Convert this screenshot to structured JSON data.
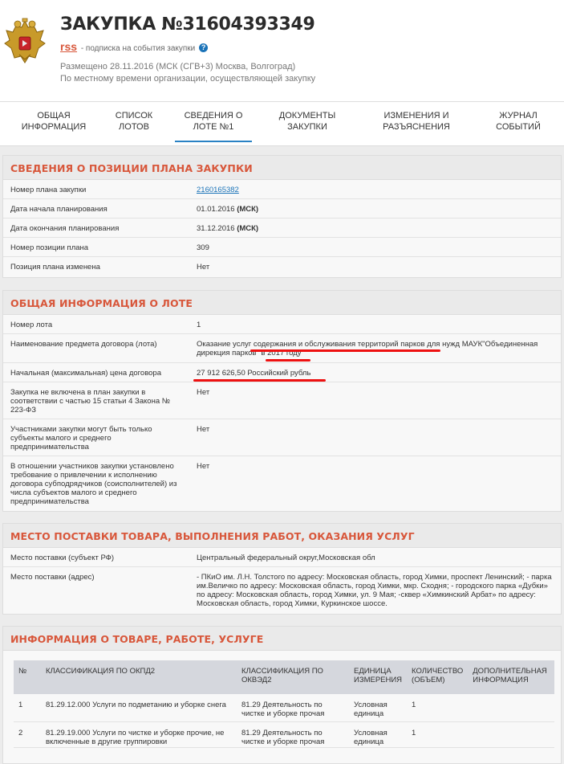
{
  "header": {
    "title": "ЗАКУПКА №31604393349",
    "rss_label": "rss",
    "rss_note": "- подписка на события закупки",
    "help_icon": "?",
    "posted_line1": "Размещено 28.11.2016 (МСК (СГВ+3) Москва, Волгоград)",
    "posted_line2": "По местному времени организации, осуществляющей закупку"
  },
  "tabs": [
    {
      "line1": "Общая",
      "line2": "информация"
    },
    {
      "line1": "Список",
      "line2": "лотов"
    },
    {
      "line1": "Сведения о",
      "line2": "лоте №1"
    },
    {
      "line1": "Документы",
      "line2": "закупки"
    },
    {
      "line1": "Изменения и",
      "line2": "разъяснения"
    },
    {
      "line1": "Журнал",
      "line2": "событий"
    }
  ],
  "plan": {
    "title": "Сведения о позиции плана закупки",
    "rows": [
      {
        "label": "Номер плана закупки",
        "value": "2160165382"
      },
      {
        "label": "Дата начала планирования",
        "value": "01.01.2016",
        "suffix": "(МСК)"
      },
      {
        "label": "Дата окончания планирования",
        "value": "31.12.2016",
        "suffix": "(МСК)"
      },
      {
        "label": "Номер позиции плана",
        "value": "309"
      },
      {
        "label": "Позиция плана изменена",
        "value": "Нет"
      }
    ]
  },
  "lot": {
    "title": "Общая информация о лоте",
    "rows": [
      {
        "label": "Номер лота",
        "value": "1"
      },
      {
        "label": "Наименование предмета договора (лота)",
        "value": "Оказание услуг содержания и обслуживания территорий парков для нужд МАУК\"Объединенная дирекция парков\" в 2017 году"
      },
      {
        "label": "Начальная (максимальная) цена договора",
        "value": "27 912 626,50 Российский рубль"
      },
      {
        "label": "Закупка не включена в план закупки в соответствии с частью 15 статьи 4 Закона № 223-ФЗ",
        "value": "Нет"
      },
      {
        "label": "Участниками закупки могут быть только субъекты малого и среднего предпринимательства",
        "value": "Нет"
      },
      {
        "label": "В отношении участников закупки установлено требование о привлечении к исполнению договора субподрядчиков (соисполнителей) из числа субъектов малого и среднего предпринимательства",
        "value": "Нет"
      }
    ]
  },
  "delivery": {
    "title": "Место поставки товара, выполнения работ, оказания услуг",
    "rows": [
      {
        "label": "Место поставки (субъект РФ)",
        "value": "Центральный федеральный округ,Московская обл"
      },
      {
        "label": "Место поставки (адрес)",
        "value": "- ПКиО им. Л.Н. Толстого по адресу: Московская область, город Химки, проспект Ленинский; - парка им.Величко по адресу: Московская область, город Химки, мкр. Сходня; - городского парка «Дубки» по адресу: Московская область, город Химки, ул. 9 Мая; -сквер «Химкинский Арбат» по адресу: Московская область, город Химки, Куркинское шоссе."
      }
    ]
  },
  "goods": {
    "title": "Информация о товаре, работе, услуге",
    "columns": [
      "№",
      "Классификация по ОКПД2",
      "Классификация по ОКВЭД2",
      "Единица измерения",
      "Количество (Объем)",
      "Дополнительная информация"
    ],
    "rows": [
      {
        "n": "1",
        "okpd": "81.29.12.000 Услуги по подметанию и уборке снега",
        "okved": "81.29 Деятельность по чистке и уборке прочая",
        "unit": "Условная единица",
        "qty": "1",
        "extra": ""
      },
      {
        "n": "2",
        "okpd": "81.29.19.000 Услуги по чистке и уборке прочие, не включенные в другие группировки",
        "okved": "81.29 Деятельность по чистке и уборке прочая",
        "unit": "Условная единица",
        "qty": "1",
        "extra": ""
      }
    ]
  },
  "colors": {
    "accent": "#d8573b",
    "link": "#1a73b8",
    "annotation": "#ee1111"
  },
  "icons": [
    "russian-emblem-icon",
    "help-icon"
  ]
}
